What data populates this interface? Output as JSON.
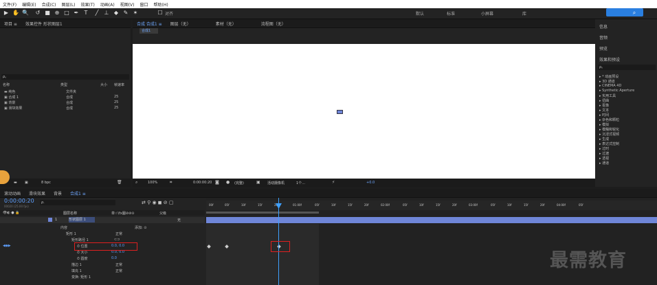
{
  "menu": [
    "文件(F)",
    "编辑(E)",
    "合成(C)",
    "图层(L)",
    "效果(T)",
    "动画(A)",
    "视图(V)",
    "窗口",
    "帮助(H)"
  ],
  "toolbar": {
    "align_label": "对齐",
    "workspaces": [
      "默认",
      "标准",
      "小屏幕",
      "库"
    ]
  },
  "project": {
    "tabs": [
      "项目 ≡",
      "效果控件 形状图层1"
    ],
    "search_placeholder": "ρ。",
    "col_headers": [
      "名称",
      "类型",
      "大小",
      "帧速率"
    ],
    "items": [
      {
        "name": "纯色",
        "type": "文件夹",
        "size": "",
        "fps": ""
      },
      {
        "name": "合成 1",
        "type": "合成",
        "size": "",
        "fps": "25"
      },
      {
        "name": "背景",
        "type": "合成",
        "size": "",
        "fps": "25"
      },
      {
        "name": "滑块效果",
        "type": "合成",
        "size": "",
        "fps": "25"
      }
    ],
    "bpc": "8 bpc"
  },
  "viewer": {
    "tabs": [
      "合成 合成1 ≡",
      "图层（无）",
      "素材（无）",
      "流程图（无）"
    ],
    "comp_tag": "合成1",
    "bottom": {
      "zoom": "100%",
      "timecode": "0:00:00:20",
      "resolution": "(完整)",
      "camera": "活动摄像机",
      "views": "1个...",
      "offset": "+0.0"
    }
  },
  "right_panel": {
    "sections": [
      "信息",
      "音频",
      "预览",
      "效果和预设"
    ],
    "search": "ρ。",
    "items": [
      "▸ * 动画预设",
      "▸ 3D 通道",
      "▸ CINEMA 4D",
      "▸ Synthetic Aperture",
      "▸ 实用工具",
      "▸ 扭曲",
      "▸ 抠像",
      "▸ 文本",
      "▸ 时间",
      "▸ 杂色和颗粒",
      "▸ 模拟",
      "▸ 模糊和锐化",
      "▸ 沉浸式视频",
      "▸ 生成",
      "▸ 表达式控制",
      "▸ 过时",
      "▸ 过渡",
      "▸ 透视",
      "▸ 通道"
    ]
  },
  "timeline": {
    "tabs": [
      "滚动动画",
      "滑块效果",
      "背景",
      "合成1 ≡"
    ],
    "timecode": "0:00:00:20",
    "timecode_sub": "00020 (25.00 fps)",
    "search": "ρ.",
    "col_headers": {
      "layer_name": "图层名称",
      "switches": "单☆\\fx圖⊘⊘⊙",
      "parent": "父级"
    },
    "layers": [
      {
        "num": "1",
        "name": "形状图层 1",
        "mode": "无"
      },
      {
        "name": "内容",
        "value": "添加: ⊙"
      },
      {
        "name": "矩形 1",
        "value": "正常"
      },
      {
        "name": "矩形路径 1",
        "value": "⊂⊃"
      },
      {
        "name": "位置",
        "value": "0.0, 0.0"
      },
      {
        "name": "大小",
        "value": "0.0, 0.0"
      },
      {
        "name": "圆度",
        "value": "0.0"
      },
      {
        "name": "描边 1",
        "value": "正常"
      },
      {
        "name": "填充 1",
        "value": "正常"
      },
      {
        "name": "变换: 矩形 1",
        "value": ""
      }
    ],
    "ruler": [
      "00f",
      "05f",
      "10f",
      "15f",
      "20f",
      "01:00f",
      "05f",
      "10f",
      "15f",
      "20f",
      "02:00f",
      "05f",
      "10f",
      "15f",
      "20f",
      "03:00f",
      "05f",
      "10f",
      "15f",
      "20f",
      "04:00f",
      "05f"
    ]
  },
  "watermark": "最需教育",
  "colors": {
    "accent": "#4a8cff",
    "playhead": "#3ea0ff",
    "highlight": "#e02020",
    "layer_bar": "#6f86d8"
  }
}
